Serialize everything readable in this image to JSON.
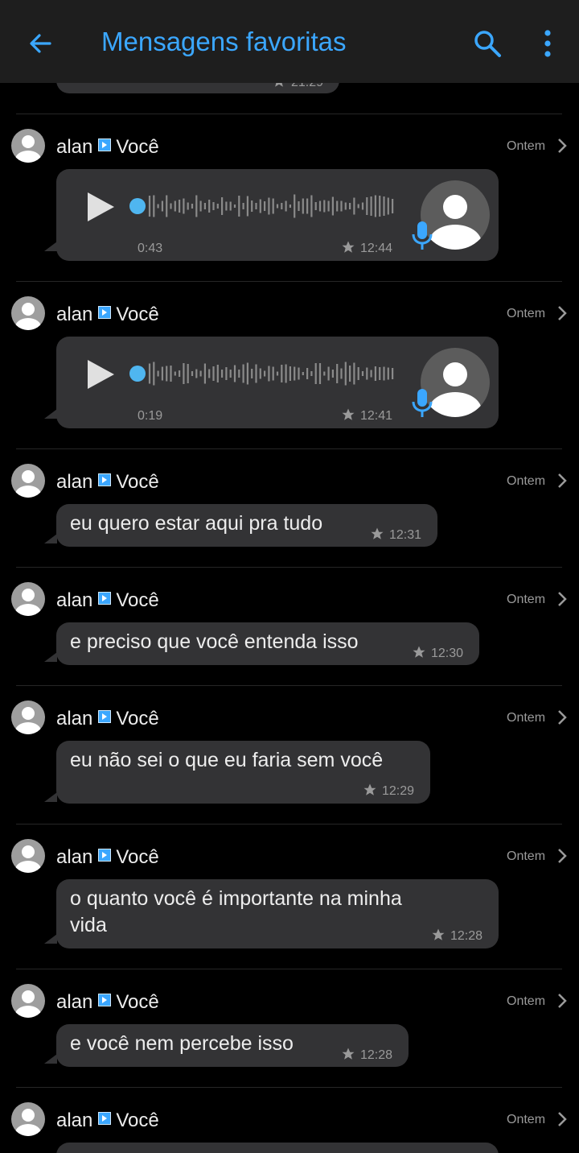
{
  "header": {
    "title": "Mensagens favoritas"
  },
  "items": [
    {
      "type": "partial",
      "time": "21:29"
    },
    {
      "type": "voice",
      "sender": "alan",
      "recipient": "Você",
      "date": "Ontem",
      "duration": "0:43",
      "time": "12:44"
    },
    {
      "type": "voice",
      "sender": "alan",
      "recipient": "Você",
      "date": "Ontem",
      "duration": "0:19",
      "time": "12:41"
    },
    {
      "type": "text",
      "sender": "alan",
      "recipient": "Você",
      "date": "Ontem",
      "text": "eu quero estar aqui pra tudo",
      "time": "12:31"
    },
    {
      "type": "text",
      "sender": "alan",
      "recipient": "Você",
      "date": "Ontem",
      "text": "e preciso que você entenda isso",
      "time": "12:30"
    },
    {
      "type": "text",
      "sender": "alan",
      "recipient": "Você",
      "date": "Ontem",
      "text": "eu não sei o que eu faria sem você",
      "time": "12:29"
    },
    {
      "type": "text",
      "sender": "alan",
      "recipient": "Você",
      "date": "Ontem",
      "text_line1": "o quanto você é importante na minha",
      "text_line2": "vida",
      "time": "12:28"
    },
    {
      "type": "text",
      "sender": "alan",
      "recipient": "Você",
      "date": "Ontem",
      "text": "e você nem percebe isso",
      "time": "12:28"
    },
    {
      "type": "header-only",
      "sender": "alan",
      "recipient": "Você",
      "date": "Ontem"
    }
  ],
  "colors": {
    "accent": "#3ba7ff",
    "bubble": "#333335",
    "background": "#000000",
    "topbar": "#1e1e1e"
  },
  "icons": {
    "back": "arrow-left-icon",
    "search": "search-icon",
    "more": "more-vert-icon",
    "star": "star-icon",
    "play": "play-icon",
    "mic": "mic-icon",
    "chevron": "chevron-right-icon",
    "forward": "forwarded-arrow-icon"
  }
}
